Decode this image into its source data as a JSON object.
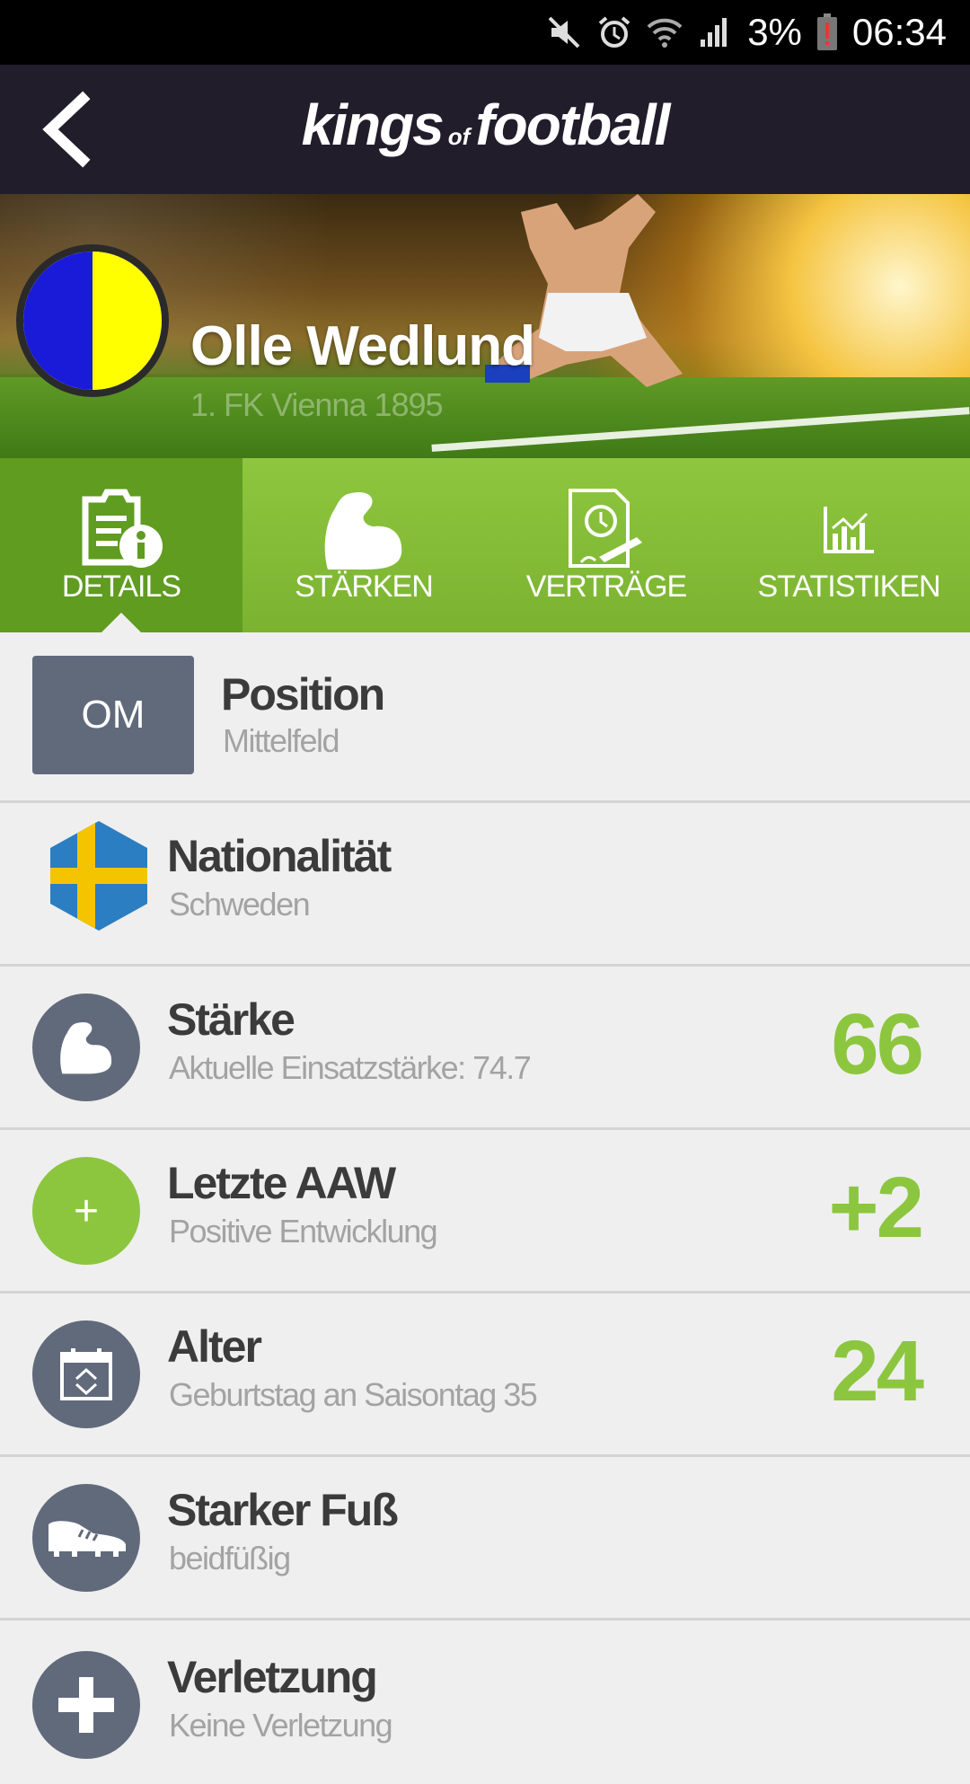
{
  "status_bar": {
    "battery": "3%",
    "time": "06:34",
    "icons": [
      "mute-icon",
      "alarm-icon",
      "wifi-icon",
      "signal-icon",
      "battery-low-icon"
    ]
  },
  "app_bar": {
    "logo_part1": "kings",
    "logo_part2": "of",
    "logo_part3": "football"
  },
  "player": {
    "name": "Olle Wedlund",
    "club": "1. FK Vienna 1895",
    "badge_colors": [
      "#1a1ad9",
      "#ffff00"
    ]
  },
  "tabs": [
    {
      "label": "DETAILS",
      "icon": "document-info-icon",
      "active": true
    },
    {
      "label": "STÄRKEN",
      "icon": "flexed-arm-icon",
      "active": false
    },
    {
      "label": "VERTRÄGE",
      "icon": "contract-clock-icon",
      "active": false
    },
    {
      "label": "STATISTIKEN",
      "icon": "bar-chart-icon",
      "active": false
    }
  ],
  "details": {
    "position": {
      "badge": "OM",
      "title": "Position",
      "subtitle": "Mittelfeld"
    },
    "nationality": {
      "title": "Nationalität",
      "subtitle": "Schweden",
      "icon": "sweden-flag-hexagon-icon"
    },
    "strength": {
      "title": "Stärke",
      "subtitle": "Aktuelle Einsatzstärke: 74.7",
      "value": "66",
      "icon": "flexed-arm-icon"
    },
    "last_aaw": {
      "title": "Letzte AAW",
      "subtitle": "Positive Entwicklung",
      "value": "+2",
      "icon_text": "+"
    },
    "age": {
      "title": "Alter",
      "subtitle": "Geburtstag an Saisontag 35",
      "value": "24",
      "icon": "calendar-icon"
    },
    "strong_foot": {
      "title": "Starker Fuß",
      "subtitle": "beidfüßig",
      "icon": "football-boot-icon"
    },
    "injury": {
      "title": "Verletzung",
      "subtitle": "Keine Verletzung",
      "icon": "medical-cross-icon"
    }
  },
  "colors": {
    "accent_green": "#8cc63f",
    "tab_active": "#5f9c20",
    "app_bar": "#221d2b",
    "icon_grey": "#616a7b"
  }
}
